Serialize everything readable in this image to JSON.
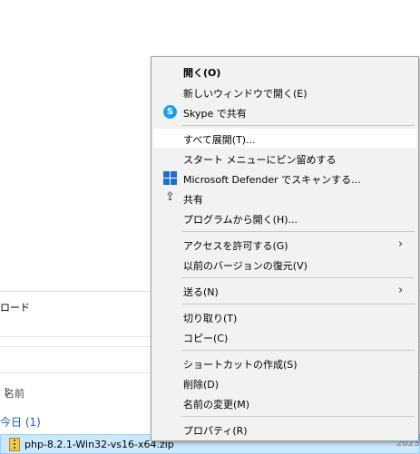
{
  "explorer": {
    "ribbon_label": "ロード",
    "column_name": "名前",
    "column_right": "[",
    "group_label": "今日 (1)",
    "file_name": "php-8.2.1-Win32-vs16-x64.zip",
    "file_date": "2023/"
  },
  "menu": {
    "items": [
      {
        "label": "開く(O)",
        "bold": true
      },
      {
        "label": "新しいウィンドウで開く(E)"
      },
      {
        "label": "Skype で共有",
        "icon": "skype-icon"
      },
      {
        "label": "すべて展開(T)..."
      },
      {
        "label": "スタート メニューにピン留めする"
      },
      {
        "label": "Microsoft Defender でスキャンする...",
        "icon": "defender-icon"
      },
      {
        "label": "共有",
        "icon": "share-icon"
      },
      {
        "label": "プログラムから開く(H)..."
      },
      {
        "label": "アクセスを許可する(G)",
        "submenu": true
      },
      {
        "label": "以前のバージョンの復元(V)"
      },
      {
        "label": "送る(N)",
        "submenu": true
      },
      {
        "label": "切り取り(T)"
      },
      {
        "label": "コピー(C)"
      },
      {
        "label": "ショートカットの作成(S)"
      },
      {
        "label": "削除(D)"
      },
      {
        "label": "名前の変更(M)"
      },
      {
        "label": "プロパティ(R)"
      }
    ],
    "submenu_glyph": "›",
    "skype_glyph": "S",
    "share_glyph": "⇪",
    "colors": {
      "highlight": "#ffffff",
      "menu_bg": "#f2f2f2",
      "selection": "#cce8ff"
    }
  }
}
